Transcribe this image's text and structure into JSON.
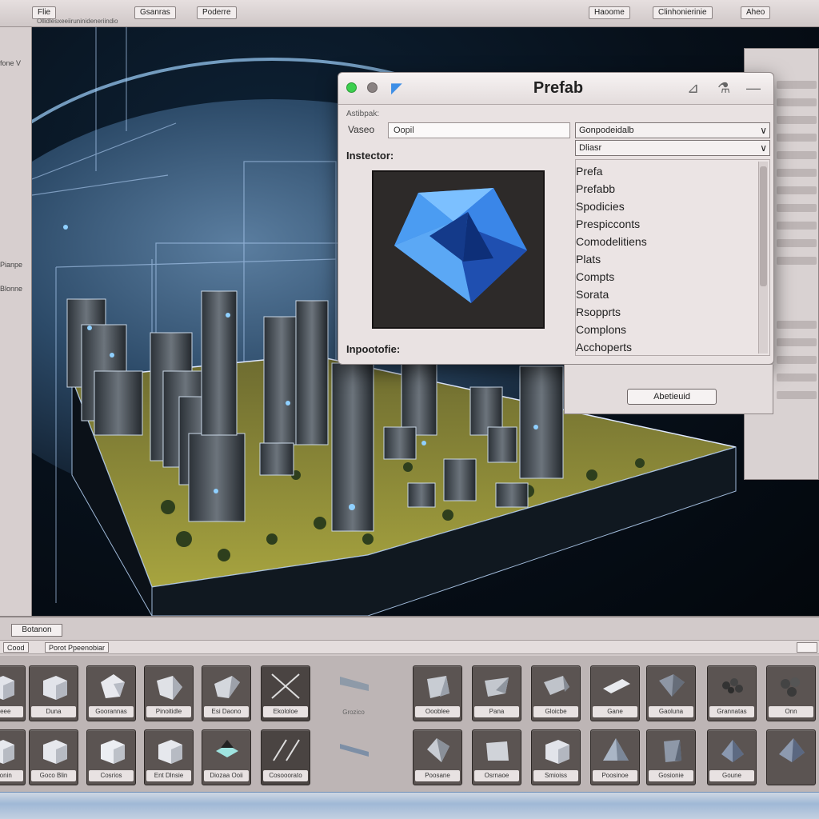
{
  "menu": {
    "items": [
      {
        "label": "Flie"
      },
      {
        "label": "Gsanras"
      },
      {
        "label": "Poderre"
      },
      {
        "label": "Haoome"
      },
      {
        "label": "Clinhonierinie"
      },
      {
        "label": "Aheo"
      }
    ],
    "subline": "Ollidlesxeeiiruninideneriindio"
  },
  "left_strip": {
    "labels": [
      "fone V",
      "Pianpe",
      "Blonne"
    ]
  },
  "dialog": {
    "title": "Prefab",
    "section_label": "Astibpak:",
    "name_label": "Vaseo",
    "name_value": "Oopil",
    "dropdown_1": "Gonpodeidalb",
    "dropdown_2": "Dliasr",
    "inspector_label": "Instector:",
    "footer_label": "Inpootofie:",
    "list_items": [
      "Prefa",
      "Prefabb",
      "Spodicies",
      "Prespicconts",
      "Comodelitiens",
      "Plats",
      "Compts",
      "Sorata",
      "Rsopprts",
      "Complons",
      "Acchoperts"
    ]
  },
  "subpanel": {
    "button_label": "Abetieuid"
  },
  "bottom": {
    "tab_label": "Botanon",
    "breadcrumb": [
      "Cood",
      "Porot Ppeenobiar"
    ],
    "assets_row1": [
      "Dlseee",
      "Duna",
      "Goorannas",
      "Pinoitidle",
      "Esi Daono",
      "Ekololoe",
      "Grozico",
      "Oooblee",
      "Pana",
      "Gloicbe",
      "Gane",
      "Gaoluna",
      "Grannatas"
    ],
    "assets_row2": [
      "Onn",
      "Oloonin",
      "Goco Blin",
      "Cosrios",
      "Ent Dlnsie",
      "Diozaa Ooii",
      "Cosooorato",
      "Poosane",
      "Osrnaoe",
      "Smioiss",
      "Poosinoe",
      "Gosionie",
      "Goune"
    ]
  },
  "colors": {
    "accent_blue": "#3f8fe6",
    "viewport_bg": "#07101a",
    "terrain": "#8a8a3a",
    "close_light": "#3ccf4e"
  }
}
